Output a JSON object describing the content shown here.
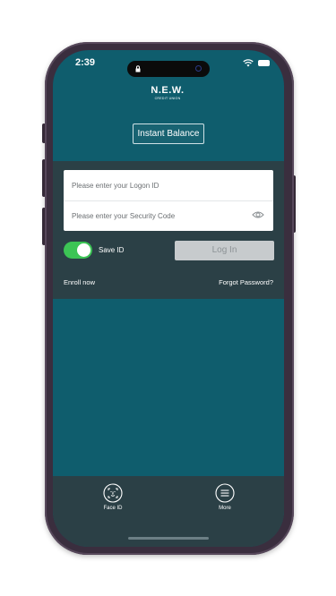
{
  "status_bar": {
    "time": "2:39",
    "icons": [
      "lock-icon",
      "camera-dot-icon",
      "wifi-icon",
      "battery-icon"
    ]
  },
  "logo": {
    "name": "N.E.W.",
    "subtitle": "CREDIT UNION"
  },
  "instant_balance": {
    "label": "Instant Balance"
  },
  "login": {
    "logon_id_placeholder": "Please enter your Logon ID",
    "logon_id_value": "",
    "security_code_placeholder": "Please enter your Security Code",
    "security_code_value": "",
    "save_id_label": "Save ID",
    "save_id_on": true,
    "login_button": "Log In",
    "enroll_link": "Enroll now",
    "forgot_link": "Forgot Password?"
  },
  "tab_bar": {
    "items": [
      {
        "label": "Face ID",
        "icon": "face-id-icon"
      },
      {
        "label": "More",
        "icon": "menu-icon"
      }
    ]
  },
  "colors": {
    "screen_background": "#0f5d6d",
    "panel_background": "#2b4046",
    "toggle_on": "#3cc455",
    "login_button_disabled": "#c7cbcd"
  }
}
